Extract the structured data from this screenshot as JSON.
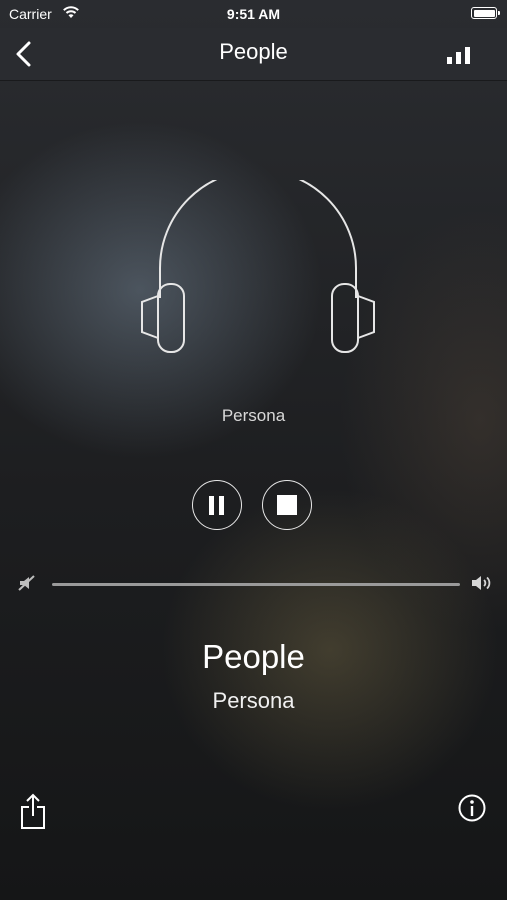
{
  "status_bar": {
    "carrier": "Carrier",
    "time": "9:51 AM"
  },
  "nav": {
    "title": "People"
  },
  "player": {
    "station_label": "Persona",
    "track_title": "People",
    "track_artist": "Persona",
    "state": "playing",
    "volume": 1.0
  },
  "icons": [
    "wifi-icon",
    "battery-icon",
    "back-chevron-icon",
    "signal-bars-icon",
    "headphones-icon",
    "pause-icon",
    "stop-icon",
    "volume-mute-icon",
    "volume-loud-icon",
    "share-icon",
    "info-icon"
  ],
  "colors": {
    "nav_background": "#2a2c30",
    "text": "#ffffff",
    "slider_track": "#9a9a9a"
  }
}
